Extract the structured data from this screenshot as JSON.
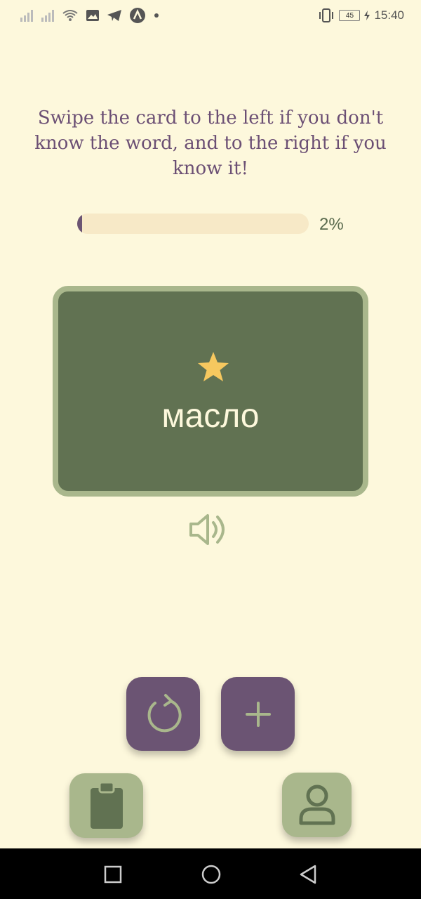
{
  "status_bar": {
    "time": "15:40",
    "battery": "45",
    "icons": [
      "signal-icon",
      "signal-icon",
      "wifi-icon",
      "image-icon",
      "telegram-icon",
      "app-icon",
      "dot-icon",
      "vibrate-icon",
      "battery-icon",
      "charging-icon"
    ]
  },
  "instructions": "Swipe the card to the left if you don't know the word, and to the right if you know it!",
  "progress": {
    "label": "2%",
    "fraction": 0.02
  },
  "card": {
    "word": "масло",
    "star_icon": "star-icon",
    "star_color": "#f6c85f"
  },
  "speaker_icon": "speaker-icon",
  "actions": {
    "restart_icon": "refresh-icon",
    "add_icon": "plus-icon"
  },
  "nav": {
    "left_icon": "clipboard-icon",
    "right_icon": "user-icon"
  },
  "system_nav": [
    "square-icon",
    "circle-icon",
    "back-triangle-icon"
  ],
  "colors": {
    "background": "#fdf8dc",
    "purple": "#6b5473",
    "green": "#617252",
    "sage": "#a9b78c"
  }
}
